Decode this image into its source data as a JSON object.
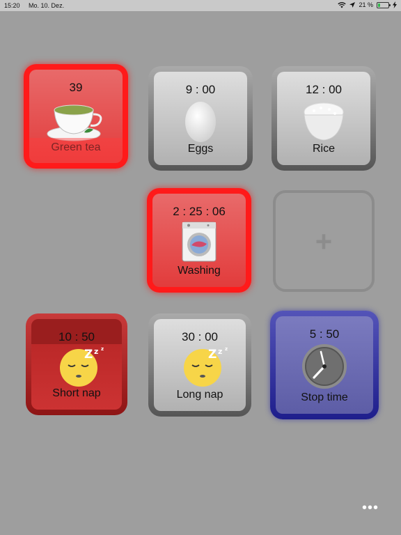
{
  "status": {
    "time": "15:20",
    "date": "Mo. 10. Dez.",
    "battery": "21 %"
  },
  "tiles": [
    {
      "time": "39",
      "label": "Green tea"
    },
    {
      "time": "9 : 00",
      "label": "Eggs"
    },
    {
      "time": "12 : 00",
      "label": "Rice"
    },
    {
      "time": "2 : 25 : 06",
      "label": "Washing"
    },
    {
      "time": "10 : 50",
      "label": "Short nap"
    },
    {
      "time": "30 : 00",
      "label": "Long nap"
    },
    {
      "time": "5 : 50",
      "label": "Stop time"
    }
  ],
  "add_symbol": "+",
  "more_symbol": "•••",
  "icons": {
    "tea": "tea-cup-icon",
    "egg": "egg-icon",
    "rice": "rice-bowl-icon",
    "washing": "washing-machine-icon",
    "sleep": "sleeping-face-icon",
    "clock": "clock-icon",
    "wifi": "wifi-icon",
    "location": "location-arrow-icon",
    "battery": "battery-icon",
    "charging": "charging-bolt-icon"
  }
}
